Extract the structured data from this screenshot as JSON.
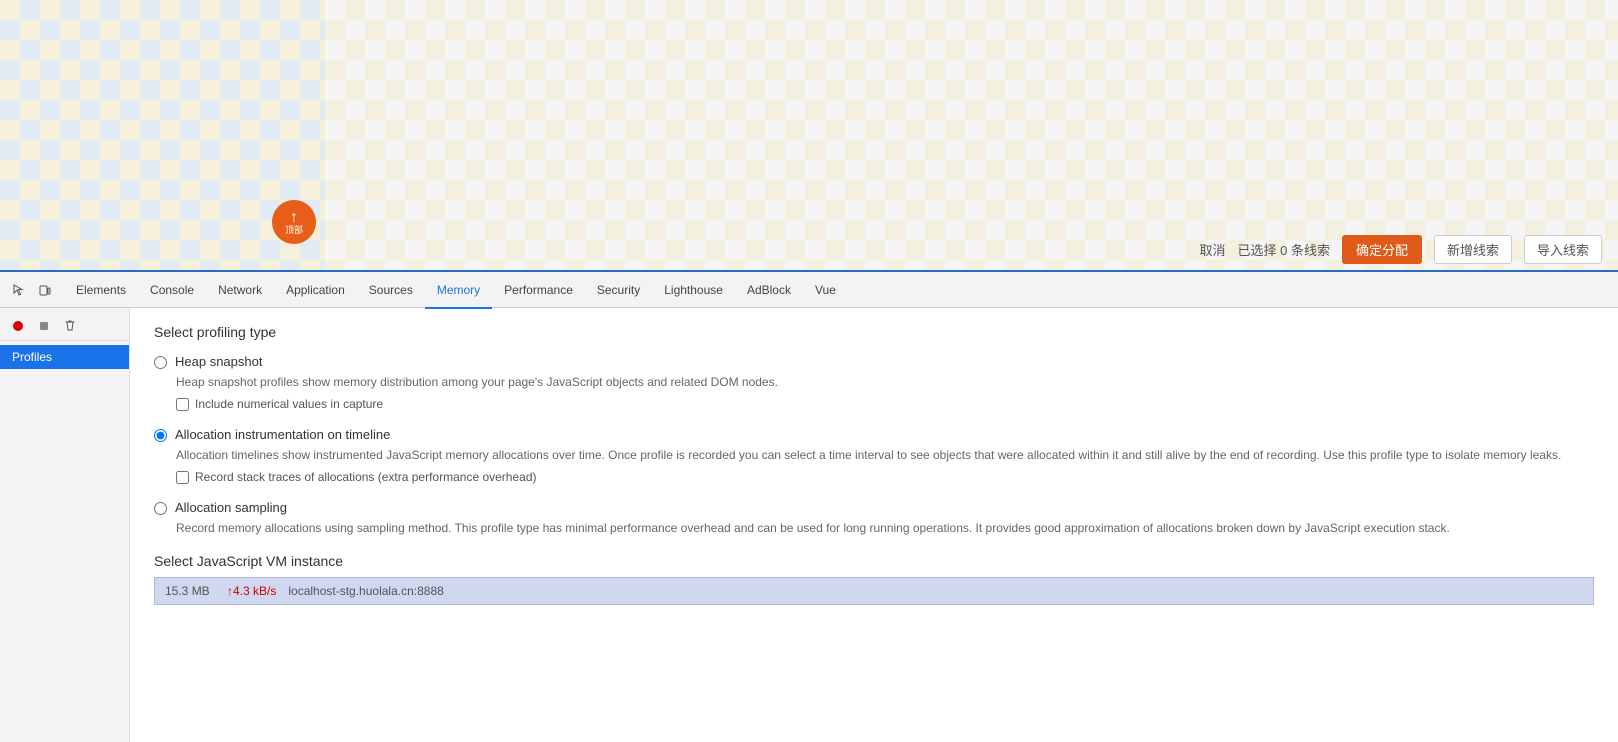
{
  "browser_top": {
    "orange_button": {
      "arrow": "↑",
      "label": "顶部"
    },
    "action_bar": {
      "cancel": "取消",
      "selected_count": "已选择 0 条线索",
      "confirm": "确定分配",
      "new_clue": "新增线索",
      "import_clue": "导入线索"
    }
  },
  "devtools": {
    "tabs": [
      {
        "id": "elements",
        "label": "Elements",
        "active": false
      },
      {
        "id": "console",
        "label": "Console",
        "active": false
      },
      {
        "id": "network",
        "label": "Network",
        "active": false
      },
      {
        "id": "application",
        "label": "Application",
        "active": false
      },
      {
        "id": "sources",
        "label": "Sources",
        "active": false
      },
      {
        "id": "memory",
        "label": "Memory",
        "active": true
      },
      {
        "id": "performance",
        "label": "Performance",
        "active": false
      },
      {
        "id": "security",
        "label": "Security",
        "active": false
      },
      {
        "id": "lighthouse",
        "label": "Lighthouse",
        "active": false
      },
      {
        "id": "adblock",
        "label": "AdBlock",
        "active": false
      },
      {
        "id": "vue",
        "label": "Vue",
        "active": false
      }
    ],
    "sidebar": {
      "items": [
        {
          "id": "profiles",
          "label": "Profiles",
          "active": true
        }
      ]
    },
    "main": {
      "select_profiling_title": "Select profiling type",
      "options": [
        {
          "id": "heap_snapshot",
          "label": "Heap snapshot",
          "selected": false,
          "description": "Heap snapshot profiles show memory distribution among your page's JavaScript objects and related DOM nodes.",
          "sub_option": {
            "label": "Include numerical values in capture",
            "checked": false
          }
        },
        {
          "id": "allocation_instrumentation",
          "label": "Allocation instrumentation on timeline",
          "selected": true,
          "description": "Allocation timelines show instrumented JavaScript memory allocations over time. Once profile is recorded you can select a time interval to see objects that were allocated within it and still alive by the end of recording. Use this profile type to isolate memory leaks.",
          "sub_option": {
            "label": "Record stack traces of allocations (extra performance overhead)",
            "checked": false
          }
        },
        {
          "id": "allocation_sampling",
          "label": "Allocation sampling",
          "selected": false,
          "description": "Record memory allocations using sampling method. This profile type has minimal performance overhead and can be used for long running operations. It provides good approximation of allocations broken down by JavaScript execution stack.",
          "sub_option": null
        }
      ],
      "vm_section_title": "Select JavaScript VM instance",
      "vm_instance": {
        "size": "15.3 MB",
        "rate": "↑4.3 kB/s",
        "url": "localhost-stg.huolala.cn:8888"
      }
    }
  }
}
